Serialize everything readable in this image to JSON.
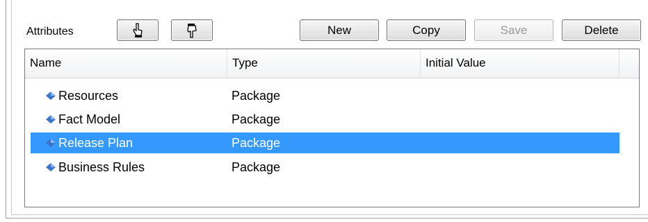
{
  "toolbar": {
    "title": "Attributes",
    "new_label": "New",
    "copy_label": "Copy",
    "save_label": "Save",
    "delete_label": "Delete"
  },
  "grid": {
    "columns": [
      "Name",
      "Type",
      "Initial Value"
    ],
    "rows": [
      {
        "name": "Resources",
        "type": "Package",
        "icon": "package-icon"
      },
      {
        "name": "Fact Model",
        "type": "Package",
        "icon": "package-icon"
      },
      {
        "name": "Release Plan",
        "type": "Package",
        "icon": "package-icon",
        "selected": true
      },
      {
        "name": "Business Rules",
        "type": "Package",
        "icon": "package-icon"
      }
    ]
  },
  "colors": {
    "selection": "#3399ff",
    "gem": "#3a73c8"
  }
}
